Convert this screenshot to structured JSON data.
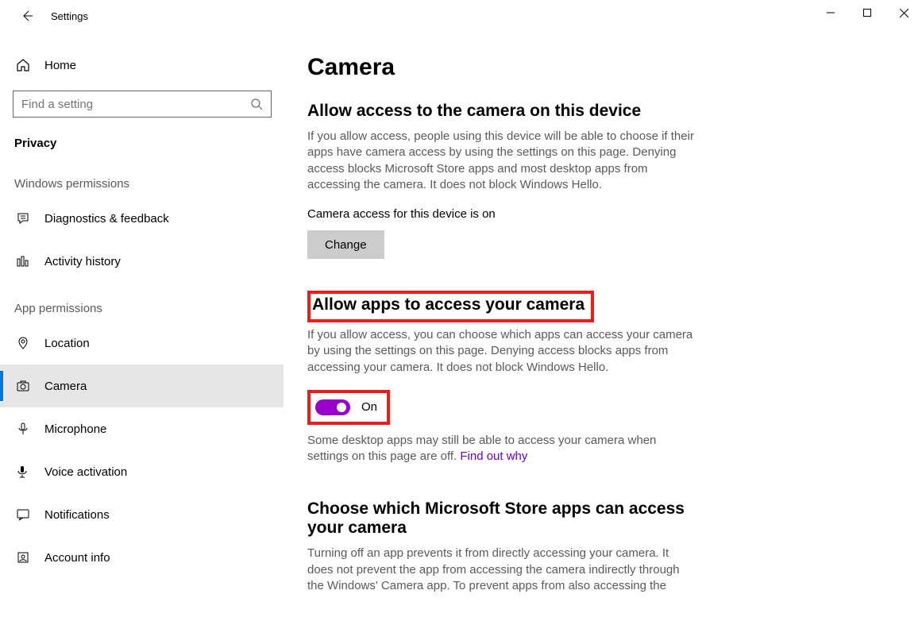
{
  "titlebar": {
    "title": "Settings"
  },
  "sidebar": {
    "home": "Home",
    "search_placeholder": "Find a setting",
    "privacy_label": "Privacy",
    "group1": "Windows permissions",
    "group2": "App permissions",
    "items_win": [
      {
        "label": "Diagnostics & feedback"
      },
      {
        "label": "Activity history"
      }
    ],
    "items_app": [
      {
        "label": "Location"
      },
      {
        "label": "Camera"
      },
      {
        "label": "Microphone"
      },
      {
        "label": "Voice activation"
      },
      {
        "label": "Notifications"
      },
      {
        "label": "Account info"
      }
    ]
  },
  "main": {
    "page_title": "Camera",
    "section1": {
      "title": "Allow access to the camera on this device",
      "desc": "If you allow access, people using this device will be able to choose if their apps have camera access by using the settings on this page. Denying access blocks Microsoft Store apps and most desktop apps from accessing the camera. It does not block Windows Hello.",
      "status": "Camera access for this device is on",
      "change_btn": "Change"
    },
    "section2": {
      "title": "Allow apps to access your camera",
      "desc": "If you allow access, you can choose which apps can access your camera by using the settings on this page. Denying access blocks apps from accessing your camera. It does not block Windows Hello.",
      "toggle_state": "On",
      "note_prefix": "Some desktop apps may still be able to access your camera when settings on this page are off. ",
      "note_link": "Find out why"
    },
    "section3": {
      "title": "Choose which Microsoft Store apps can access your camera",
      "desc": "Turning off an app prevents it from directly accessing your camera. It does not prevent the app from accessing the camera indirectly through the Windows' Camera app. To prevent apps from also accessing the"
    }
  }
}
